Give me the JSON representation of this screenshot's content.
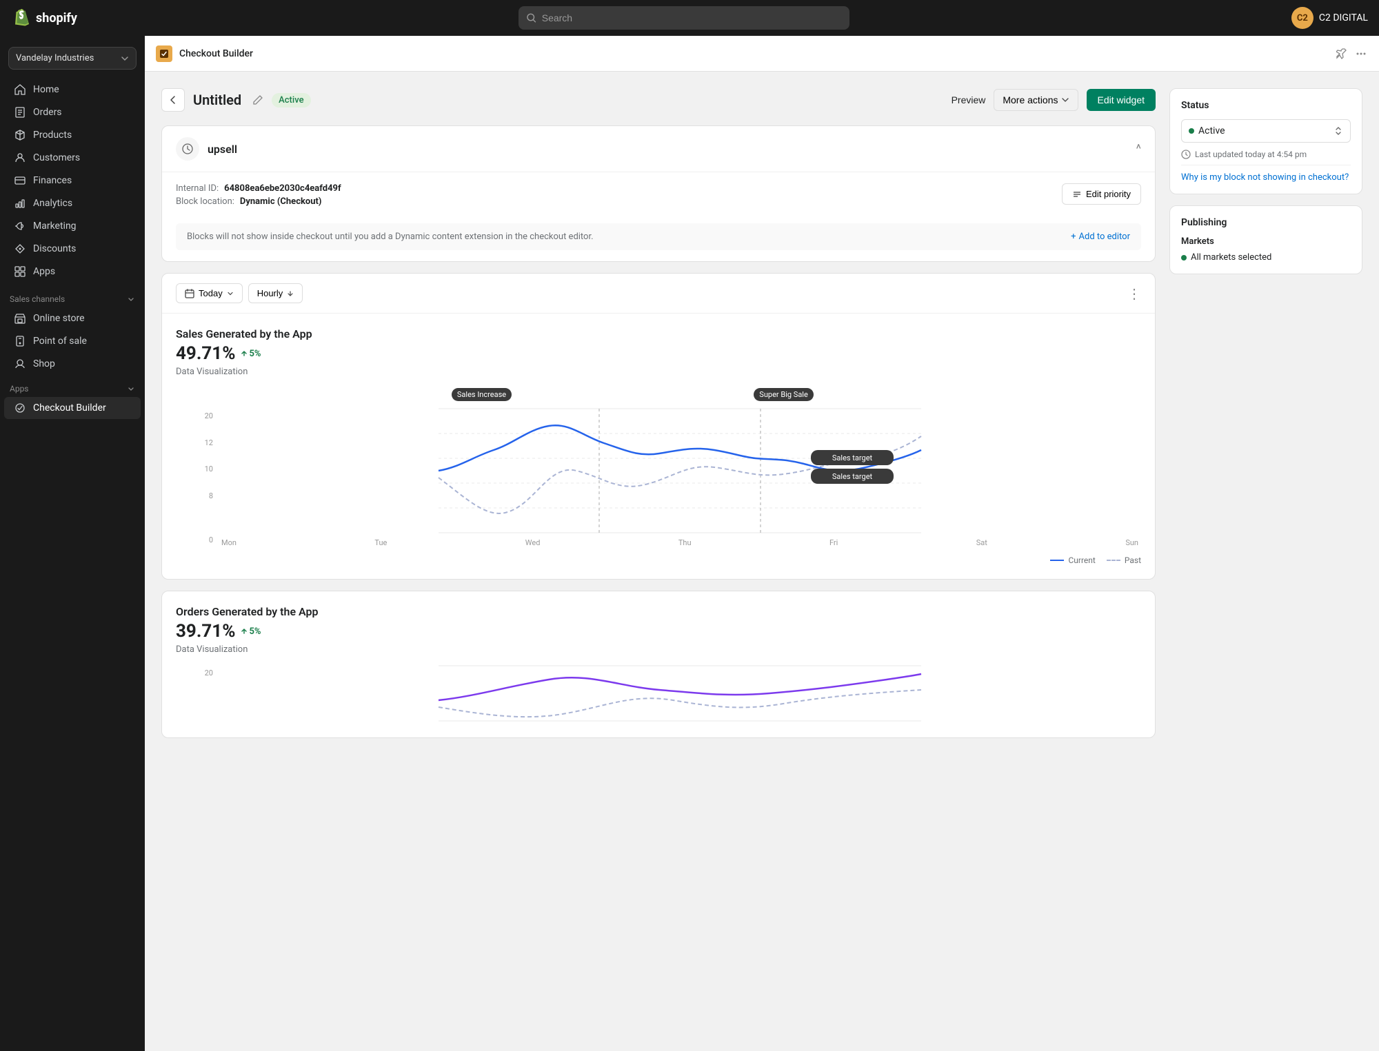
{
  "topnav": {
    "logo_text": "shopify",
    "search_placeholder": "Search",
    "user_initials": "C2",
    "user_name": "C2 DIGITAL"
  },
  "sidebar": {
    "store_name": "Vandelay Industries",
    "nav_items": [
      {
        "id": "home",
        "label": "Home",
        "icon": "home"
      },
      {
        "id": "orders",
        "label": "Orders",
        "icon": "orders"
      },
      {
        "id": "products",
        "label": "Products",
        "icon": "products"
      },
      {
        "id": "customers",
        "label": "Customers",
        "icon": "customers"
      },
      {
        "id": "finances",
        "label": "Finances",
        "icon": "finances"
      },
      {
        "id": "analytics",
        "label": "Analytics",
        "icon": "analytics"
      },
      {
        "id": "marketing",
        "label": "Marketing",
        "icon": "marketing"
      },
      {
        "id": "discounts",
        "label": "Discounts",
        "icon": "discounts"
      },
      {
        "id": "apps",
        "label": "Apps",
        "icon": "apps"
      }
    ],
    "sales_channels_label": "Sales channels",
    "channels": [
      {
        "id": "online-store",
        "label": "Online store",
        "icon": "store"
      },
      {
        "id": "point-of-sale",
        "label": "Point of sale",
        "icon": "pos"
      },
      {
        "id": "shop",
        "label": "Shop",
        "icon": "shop"
      }
    ],
    "apps_label": "Apps",
    "app_items": [
      {
        "id": "checkout-builder",
        "label": "Checkout Builder",
        "icon": "checkout"
      }
    ]
  },
  "app_header": {
    "title": "Checkout Builder",
    "pin_label": "Pin",
    "more_label": "More"
  },
  "widget": {
    "title": "Untitled",
    "status": "Active",
    "preview_label": "Preview",
    "more_actions_label": "More actions",
    "edit_widget_label": "Edit widget"
  },
  "block": {
    "title": "upsell",
    "internal_id_label": "Internal ID:",
    "internal_id_value": "64808ea6ebe2030c4eafd49f",
    "block_location_label": "Block location:",
    "block_location_value": "Dynamic (Checkout)",
    "edit_priority_label": "Edit priority",
    "notice_text": "Blocks will not show inside checkout until you add a Dynamic content extension in the checkout editor.",
    "add_to_editor_label": "Add to editor"
  },
  "analytics": {
    "date_filter": "Today",
    "interval_filter": "Hourly",
    "chart1": {
      "title": "Sales Generated by the App",
      "value": "49.71%",
      "change": "5%",
      "subtitle": "Data Visualization",
      "y_labels": [
        "20",
        "12",
        "10",
        "8",
        "0"
      ],
      "x_labels": [
        "Mon",
        "Tue",
        "Wed",
        "Thu",
        "Fri",
        "Sat",
        "Sun"
      ],
      "labels": [
        {
          "text": "Sales Increase",
          "x_pct": 34
        },
        {
          "text": "Super Big Sale",
          "x_pct": 63
        }
      ],
      "target_labels": [
        {
          "text": "Sales target",
          "x_pct": 77
        },
        {
          "text": "Sales target",
          "x_pct": 77
        }
      ],
      "legend_current": "Current",
      "legend_past": "Past"
    },
    "chart2": {
      "title": "Orders Generated by the App",
      "value": "39.71%",
      "change": "5%",
      "subtitle": "Data Visualization",
      "y_labels": [
        "20",
        ""
      ],
      "x_labels": []
    }
  },
  "status_panel": {
    "title": "Status",
    "status_value": "Active",
    "last_updated_label": "Last updated today at 4:54 pm",
    "why_label": "Why is my block not showing in checkout?"
  },
  "publishing_panel": {
    "title": "Publishing",
    "markets_title": "Markets",
    "markets_value": "All markets selected"
  }
}
